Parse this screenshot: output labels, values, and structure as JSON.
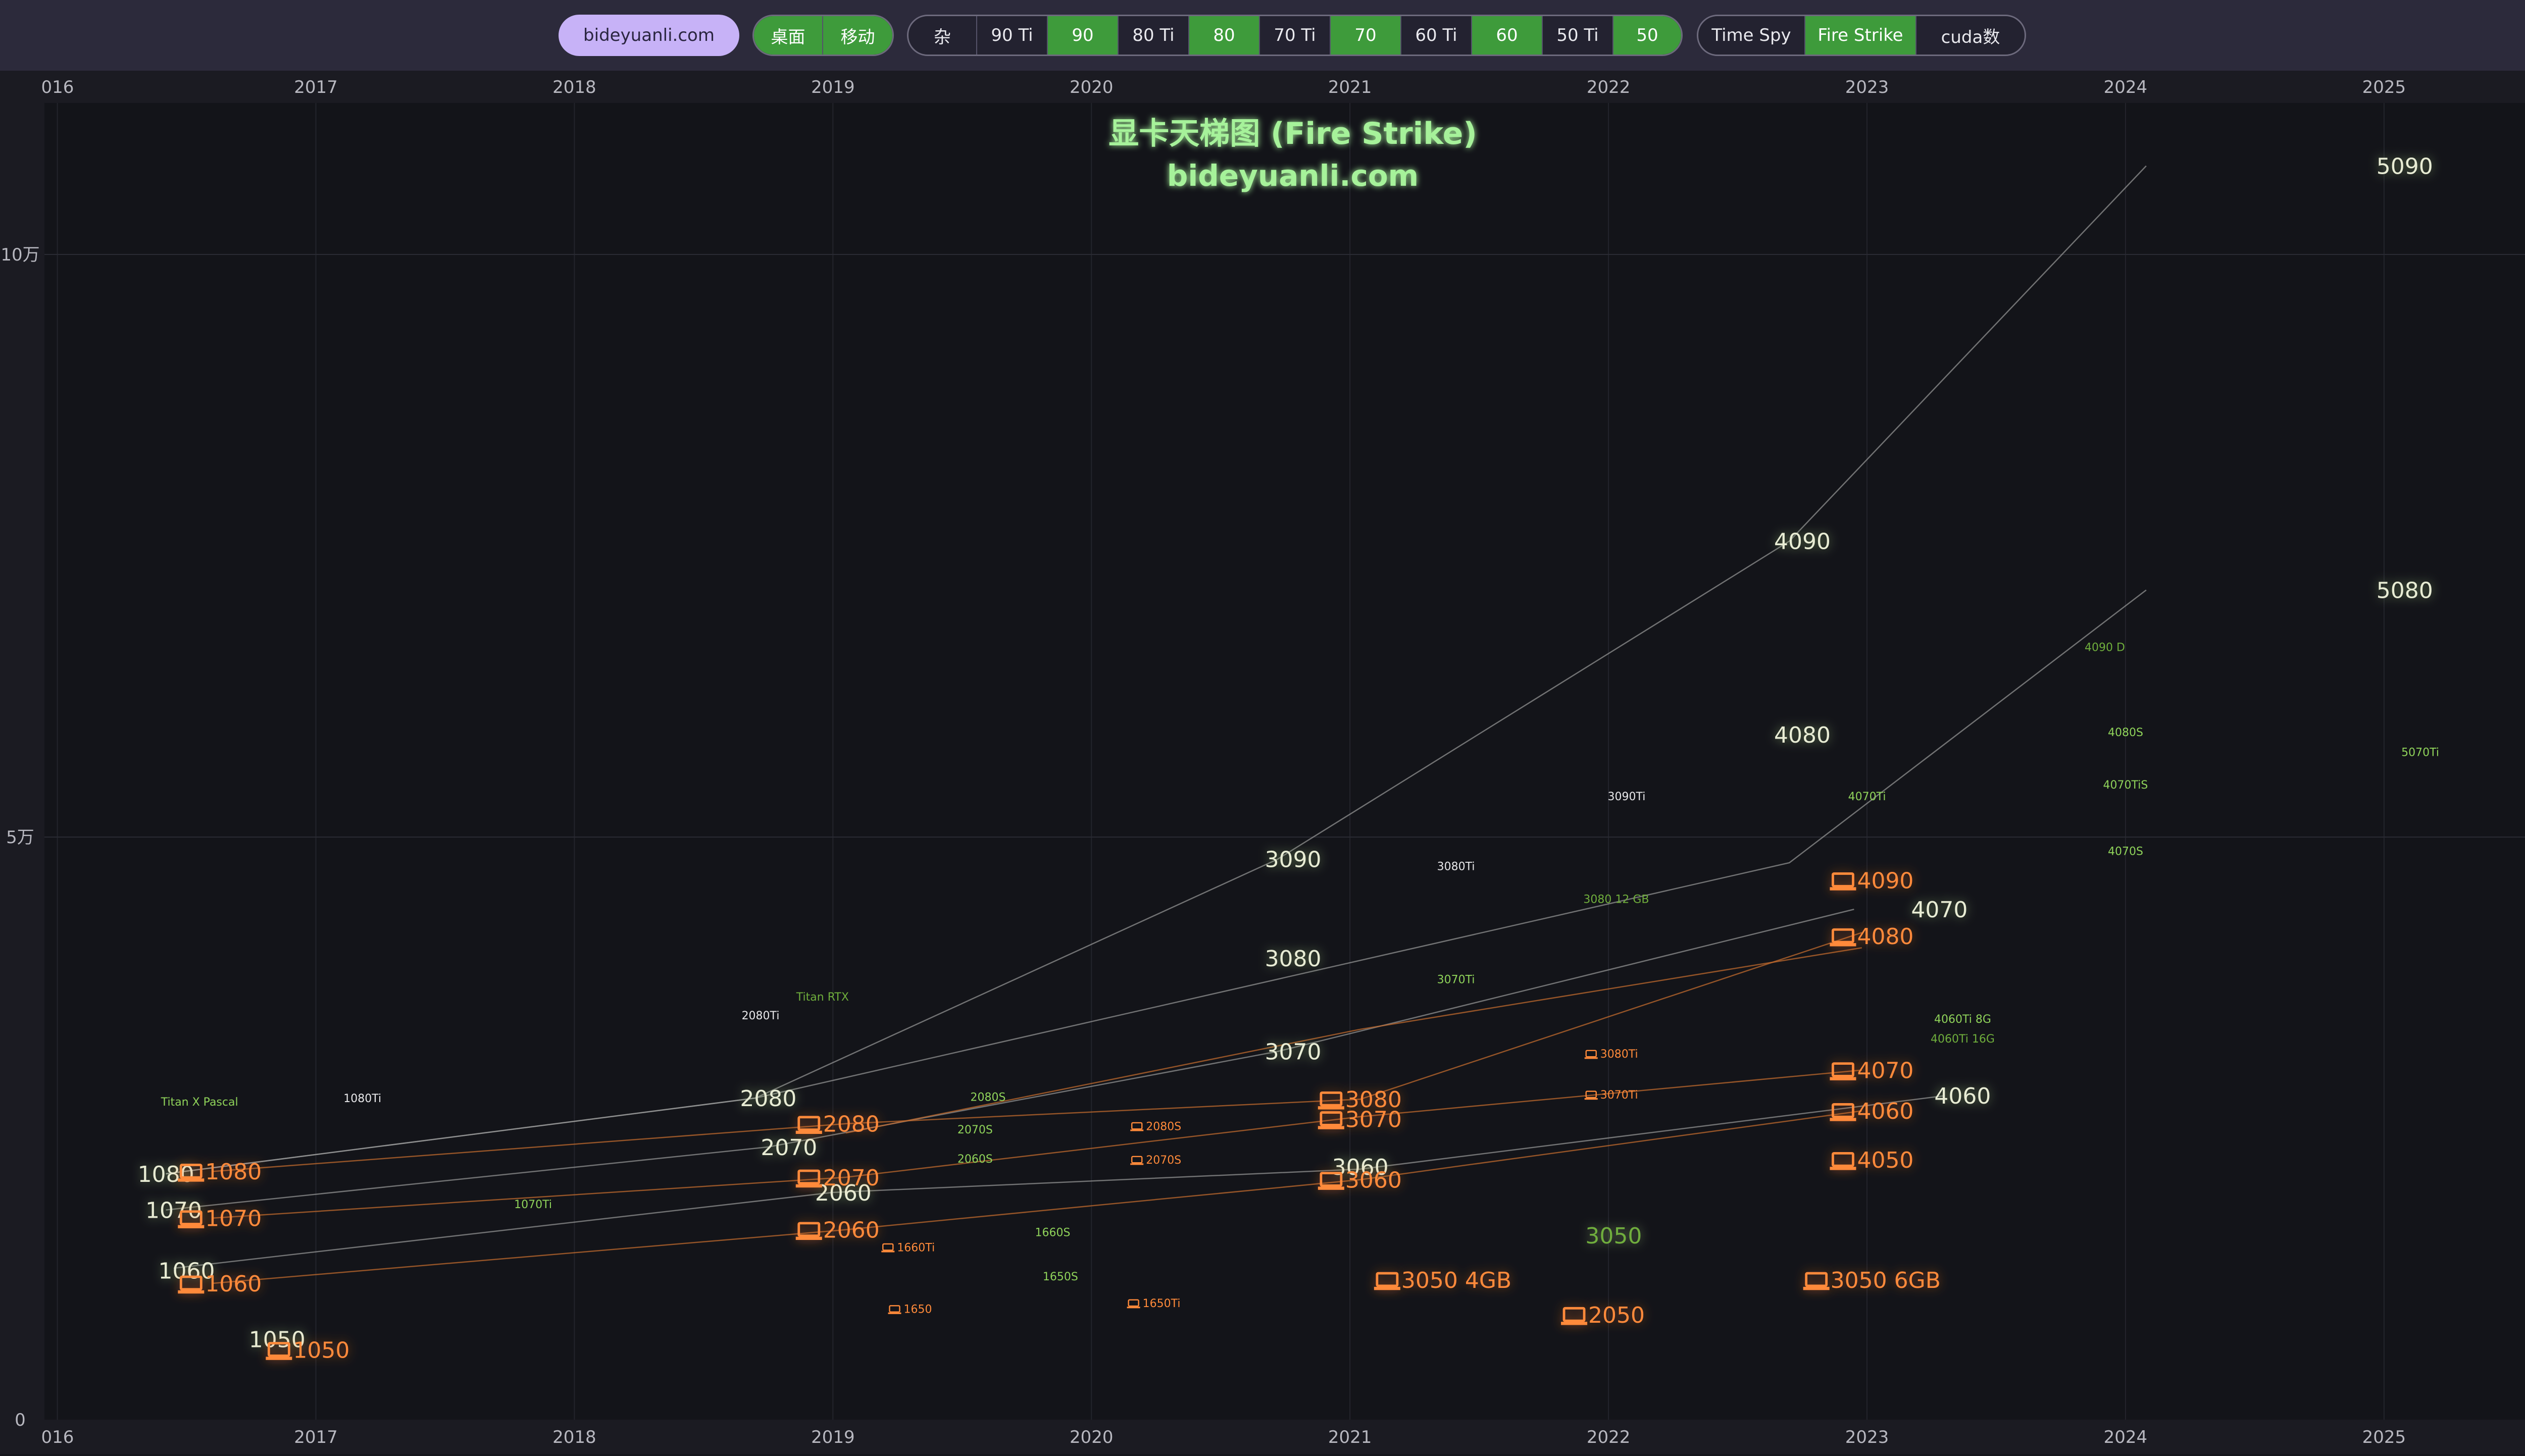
{
  "toolbar": {
    "site_button": "bideyuanli.com",
    "platform": [
      {
        "label": "桌面",
        "active": true
      },
      {
        "label": "移动",
        "active": true
      }
    ],
    "tiers": [
      {
        "label": "杂",
        "active": false
      },
      {
        "label": "90 Ti",
        "active": false
      },
      {
        "label": "90",
        "active": true
      },
      {
        "label": "80 Ti",
        "active": false
      },
      {
        "label": "80",
        "active": true
      },
      {
        "label": "70 Ti",
        "active": false
      },
      {
        "label": "70",
        "active": true
      },
      {
        "label": "60 Ti",
        "active": false
      },
      {
        "label": "60",
        "active": true
      },
      {
        "label": "50 Ti",
        "active": false
      },
      {
        "label": "50",
        "active": true
      }
    ],
    "metrics": [
      {
        "label": "Time Spy",
        "active": false
      },
      {
        "label": "Fire Strike",
        "active": true
      },
      {
        "label": "cuda数",
        "active": false
      }
    ],
    "settings_icon": "gear-icon"
  },
  "chart_data": {
    "type": "scatter",
    "title": "显卡天梯图 (Fire Strike)",
    "subtitle": "bideyuanli.com",
    "x_axis": {
      "range": [
        2015.95,
        2025.6
      ],
      "ticks": [
        "016",
        "2017",
        "2018",
        "2019",
        "2020",
        "2021",
        "2022",
        "2023",
        "2024",
        "2025"
      ],
      "tick_values": [
        2016,
        2017,
        2018,
        2019,
        2020,
        2021,
        2022,
        2023,
        2024,
        2025
      ]
    },
    "y_axis": {
      "range": [
        0,
        113000
      ],
      "ticks": [
        "0",
        "5万",
        "10万"
      ],
      "tick_values": [
        0,
        50000,
        100000
      ]
    },
    "colors": {
      "desktop_label": "#e8ecd4",
      "desktop_glow": "#b5e08a",
      "desktop_line": "#9a9a9a",
      "laptop": "#ff8a3a",
      "laptop_line": "#c0692e",
      "green": "#8fd35a",
      "dim_green": "#6fae3c",
      "title": "#a6f29a",
      "background": "#131419"
    },
    "series": [
      {
        "type": "desktop",
        "points": [
          [
            2016.42,
            21100
          ],
          [
            2018.7,
            27600
          ],
          [
            2020.72,
            37800
          ],
          [
            2022.7,
            47800
          ],
          [
            2024.08,
            71200
          ]
        ]
      },
      {
        "type": "desktop",
        "points": [
          [
            2016.42,
            21100
          ],
          [
            2018.7,
            27600
          ],
          [
            2020.72,
            48100
          ],
          [
            2022.7,
            75400
          ],
          [
            2024.08,
            107600
          ]
        ]
      },
      {
        "type": "desktop",
        "points": [
          [
            2016.42,
            18000
          ],
          [
            2018.75,
            23400
          ],
          [
            2020.72,
            31600
          ],
          [
            2022.95,
            43800
          ]
        ]
      },
      {
        "type": "desktop",
        "points": [
          [
            2016.45,
            13000
          ],
          [
            2019.0,
            19500
          ],
          [
            2021.04,
            21500
          ],
          [
            2023.3,
            27800
          ]
        ]
      },
      {
        "type": "laptop",
        "points": [
          [
            2016.6,
            21300
          ],
          [
            2019.05,
            25400
          ],
          [
            2021.04,
            27500
          ],
          [
            2022.98,
            41800
          ]
        ]
      },
      {
        "type": "laptop",
        "points": [
          [
            2016.6,
            17300
          ],
          [
            2019.05,
            20800
          ],
          [
            2021.04,
            26000
          ],
          [
            2022.98,
            30000
          ]
        ]
      },
      {
        "type": "laptop",
        "points": [
          [
            2016.6,
            11700
          ],
          [
            2019.05,
            16300
          ],
          [
            2021.04,
            20600
          ],
          [
            2022.98,
            26500
          ]
        ]
      },
      {
        "type": "laptop",
        "points": [
          [
            2019.05,
            24600
          ],
          [
            2021.04,
            33500
          ],
          [
            2022.98,
            40500
          ]
        ]
      }
    ],
    "points": [
      {
        "label": "5090",
        "x": 2025.08,
        "y": 107600,
        "kind": "desktop",
        "size": "large"
      },
      {
        "label": "4090",
        "x": 2022.75,
        "y": 75400,
        "kind": "desktop",
        "size": "large"
      },
      {
        "label": "5080",
        "x": 2025.08,
        "y": 71200,
        "kind": "desktop",
        "size": "large"
      },
      {
        "label": "4080",
        "x": 2022.75,
        "y": 58800,
        "kind": "desktop",
        "size": "large"
      },
      {
        "label": "3090",
        "x": 2020.78,
        "y": 48100,
        "kind": "desktop",
        "size": "large"
      },
      {
        "label": "3080",
        "x": 2020.78,
        "y": 39600,
        "kind": "desktop",
        "size": "large"
      },
      {
        "label": "3070",
        "x": 2020.78,
        "y": 31600,
        "kind": "desktop",
        "size": "large"
      },
      {
        "label": "2080",
        "x": 2018.75,
        "y": 27600,
        "kind": "desktop",
        "size": "large"
      },
      {
        "label": "2070",
        "x": 2018.83,
        "y": 23400,
        "kind": "desktop",
        "size": "large"
      },
      {
        "label": "2060",
        "x": 2019.04,
        "y": 19500,
        "kind": "desktop",
        "size": "large"
      },
      {
        "label": "1080",
        "x": 2016.42,
        "y": 21100,
        "kind": "desktop",
        "size": "large"
      },
      {
        "label": "1070",
        "x": 2016.45,
        "y": 18000,
        "kind": "desktop",
        "size": "large"
      },
      {
        "label": "1060",
        "x": 2016.5,
        "y": 12800,
        "kind": "desktop",
        "size": "large"
      },
      {
        "label": "1050",
        "x": 2016.85,
        "y": 6900,
        "kind": "desktop",
        "size": "large"
      },
      {
        "label": "4070",
        "x": 2023.28,
        "y": 43800,
        "kind": "desktop",
        "size": "large"
      },
      {
        "label": "4060",
        "x": 2023.37,
        "y": 27800,
        "kind": "desktop",
        "size": "large"
      },
      {
        "label": "3060",
        "x": 2021.04,
        "y": 21700,
        "kind": "desktop",
        "size": "large"
      },
      {
        "label": "3050",
        "x": 2022.02,
        "y": 15800,
        "kind": "dimgreen",
        "size": "large"
      },
      {
        "label": "4090",
        "x": 2023.02,
        "y": 46300,
        "kind": "laptop",
        "size": "large"
      },
      {
        "label": "4080",
        "x": 2023.02,
        "y": 41500,
        "kind": "laptop",
        "size": "large"
      },
      {
        "label": "4070",
        "x": 2023.02,
        "y": 30000,
        "kind": "laptop",
        "size": "large"
      },
      {
        "label": "4060",
        "x": 2023.02,
        "y": 26500,
        "kind": "laptop",
        "size": "large"
      },
      {
        "label": "4050",
        "x": 2023.02,
        "y": 22300,
        "kind": "laptop",
        "size": "large"
      },
      {
        "label": "3080",
        "x": 2021.04,
        "y": 27500,
        "kind": "laptop",
        "size": "large"
      },
      {
        "label": "3070",
        "x": 2021.04,
        "y": 25800,
        "kind": "laptop",
        "size": "large"
      },
      {
        "label": "3060",
        "x": 2021.04,
        "y": 20600,
        "kind": "laptop",
        "size": "large"
      },
      {
        "label": "3050 4GB",
        "x": 2021.36,
        "y": 12000,
        "kind": "laptop",
        "size": "large"
      },
      {
        "label": "3050 6GB",
        "x": 2023.02,
        "y": 12000,
        "kind": "laptop",
        "size": "large"
      },
      {
        "label": "2050",
        "x": 2021.98,
        "y": 9000,
        "kind": "laptop",
        "size": "large"
      },
      {
        "label": "2080",
        "x": 2019.02,
        "y": 25400,
        "kind": "laptop",
        "size": "large"
      },
      {
        "label": "2070",
        "x": 2019.02,
        "y": 20800,
        "kind": "laptop",
        "size": "large"
      },
      {
        "label": "2060",
        "x": 2019.02,
        "y": 16300,
        "kind": "laptop",
        "size": "large"
      },
      {
        "label": "1080",
        "x": 2016.63,
        "y": 21300,
        "kind": "laptop",
        "size": "large"
      },
      {
        "label": "1070",
        "x": 2016.63,
        "y": 17300,
        "kind": "laptop",
        "size": "large"
      },
      {
        "label": "1060",
        "x": 2016.63,
        "y": 11700,
        "kind": "laptop",
        "size": "large"
      },
      {
        "label": "1050",
        "x": 2016.97,
        "y": 6000,
        "kind": "laptop",
        "size": "large"
      },
      {
        "label": "Titan X Pascal",
        "x": 2016.55,
        "y": 27300,
        "kind": "green",
        "size": "small"
      },
      {
        "label": "1080Ti",
        "x": 2017.18,
        "y": 27600,
        "kind": "white",
        "size": "small"
      },
      {
        "label": "1070Ti",
        "x": 2017.84,
        "y": 18500,
        "kind": "green",
        "size": "small"
      },
      {
        "label": "2080Ti",
        "x": 2018.72,
        "y": 34700,
        "kind": "white",
        "size": "small"
      },
      {
        "label": "Titan RTX",
        "x": 2018.96,
        "y": 36300,
        "kind": "dimgreen",
        "size": "small"
      },
      {
        "label": "3090Ti",
        "x": 2022.07,
        "y": 53500,
        "kind": "white",
        "size": "small"
      },
      {
        "label": "3080Ti",
        "x": 2021.41,
        "y": 47500,
        "kind": "white",
        "size": "small"
      },
      {
        "label": "3070Ti",
        "x": 2021.41,
        "y": 37800,
        "kind": "green",
        "size": "small"
      },
      {
        "label": "3080 12 GB",
        "x": 2022.03,
        "y": 44700,
        "kind": "dimgreen",
        "size": "small"
      },
      {
        "label": "4070Ti",
        "x": 2023.0,
        "y": 53500,
        "kind": "green",
        "size": "small"
      },
      {
        "label": "4090 D",
        "x": 2023.92,
        "y": 66300,
        "kind": "dimgreen",
        "size": "small"
      },
      {
        "label": "5070Ti",
        "x": 2025.14,
        "y": 57300,
        "kind": "green",
        "size": "small"
      },
      {
        "label": "4060Ti 8G",
        "x": 2023.37,
        "y": 34400,
        "kind": "green",
        "size": "small"
      },
      {
        "label": "4060Ti 16G",
        "x": 2023.37,
        "y": 32700,
        "kind": "dimgreen",
        "size": "small"
      },
      {
        "label": "4080S",
        "x": 2024.0,
        "y": 59000,
        "kind": "green",
        "size": "small"
      },
      {
        "label": "4070TiS",
        "x": 2024.0,
        "y": 54500,
        "kind": "green",
        "size": "small"
      },
      {
        "label": "4070S",
        "x": 2024.0,
        "y": 48800,
        "kind": "green",
        "size": "small"
      },
      {
        "label": "2080S",
        "x": 2019.6,
        "y": 27700,
        "kind": "green",
        "size": "small"
      },
      {
        "label": "2070S",
        "x": 2019.55,
        "y": 24900,
        "kind": "green",
        "size": "small"
      },
      {
        "label": "2060S",
        "x": 2019.55,
        "y": 22400,
        "kind": "green",
        "size": "small"
      },
      {
        "label": "1660S",
        "x": 2019.85,
        "y": 16100,
        "kind": "green",
        "size": "small"
      },
      {
        "label": "1650S",
        "x": 2019.88,
        "y": 12300,
        "kind": "green",
        "size": "small"
      },
      {
        "label": "1660Ti",
        "x": 2019.3,
        "y": 14800,
        "kind": "laptop",
        "size": "small"
      },
      {
        "label": "1650",
        "x": 2019.3,
        "y": 9500,
        "kind": "laptop",
        "size": "small"
      },
      {
        "label": "2080S",
        "x": 2020.25,
        "y": 25200,
        "kind": "laptop",
        "size": "small"
      },
      {
        "label": "2070S",
        "x": 2020.25,
        "y": 22300,
        "kind": "laptop",
        "size": "small"
      },
      {
        "label": "1650Ti",
        "x": 2020.25,
        "y": 10000,
        "kind": "laptop",
        "size": "small"
      },
      {
        "label": "3080Ti",
        "x": 2022.02,
        "y": 31400,
        "kind": "laptop",
        "size": "small"
      },
      {
        "label": "3070Ti",
        "x": 2022.02,
        "y": 27900,
        "kind": "laptop",
        "size": "small"
      }
    ]
  }
}
